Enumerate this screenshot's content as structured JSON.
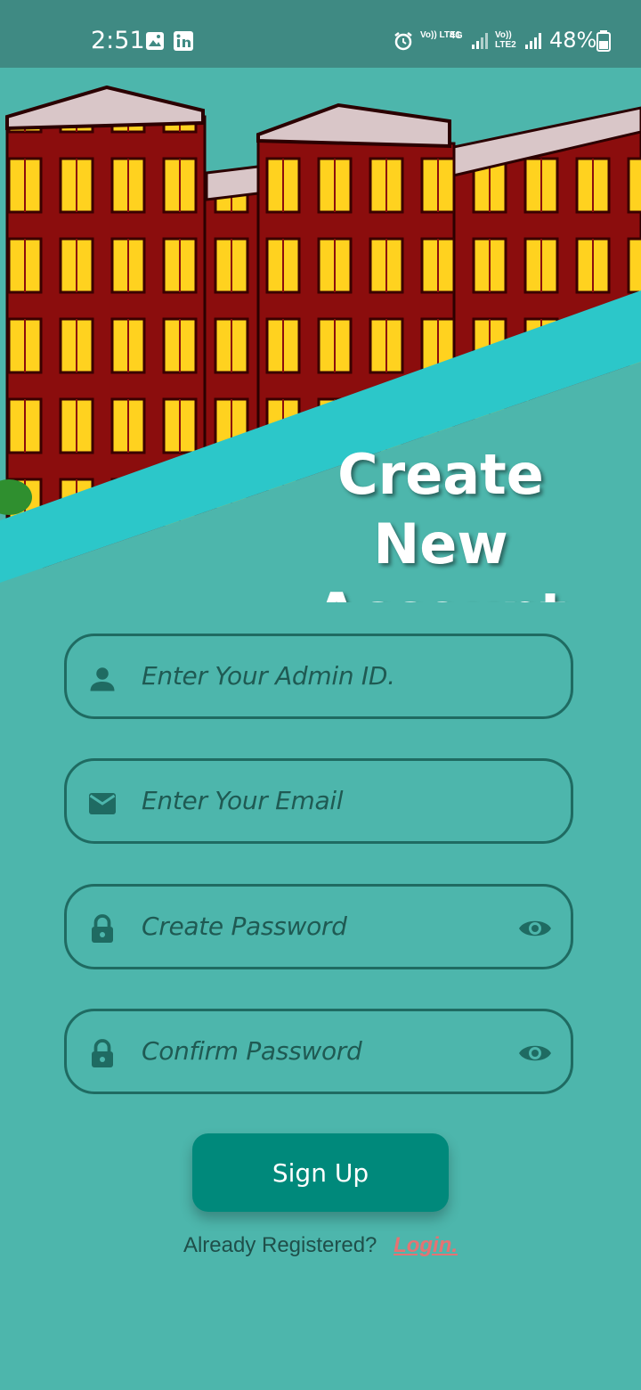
{
  "status_bar": {
    "time": "2:51",
    "battery": "48%",
    "icons": [
      "gallery-icon",
      "linkedin-icon",
      "alarm-icon",
      "lte1-signal-icon",
      "lte2-signal-icon",
      "battery-icon"
    ],
    "net1": "Vo)) LTE1",
    "net2": "Vo)) LTE2",
    "net_type": "4G"
  },
  "hero": {
    "title": "Create New Account",
    "colors": {
      "stripe": "#2cc7c9",
      "building": "#8b0d0d",
      "window": "#ffd21f",
      "roof": "#d9c6c8"
    }
  },
  "form": {
    "admin_id": {
      "placeholder": "Enter Your Admin ID.",
      "icon": "person-icon"
    },
    "email": {
      "placeholder": "Enter Your Email",
      "icon": "mail-icon"
    },
    "create_password": {
      "placeholder": "Create Password",
      "icon": "lock-icon",
      "toggle": "eye-icon"
    },
    "confirm_password": {
      "placeholder": "Confirm Password",
      "icon": "lock-icon",
      "toggle": "eye-icon"
    },
    "signup_label": "Sign Up"
  },
  "footer": {
    "text": "Already Registered?",
    "link": "Login."
  },
  "colors": {
    "background": "#4db6ac",
    "button": "#00897b",
    "link": "#e57373",
    "field_border": "#1f6b62"
  }
}
